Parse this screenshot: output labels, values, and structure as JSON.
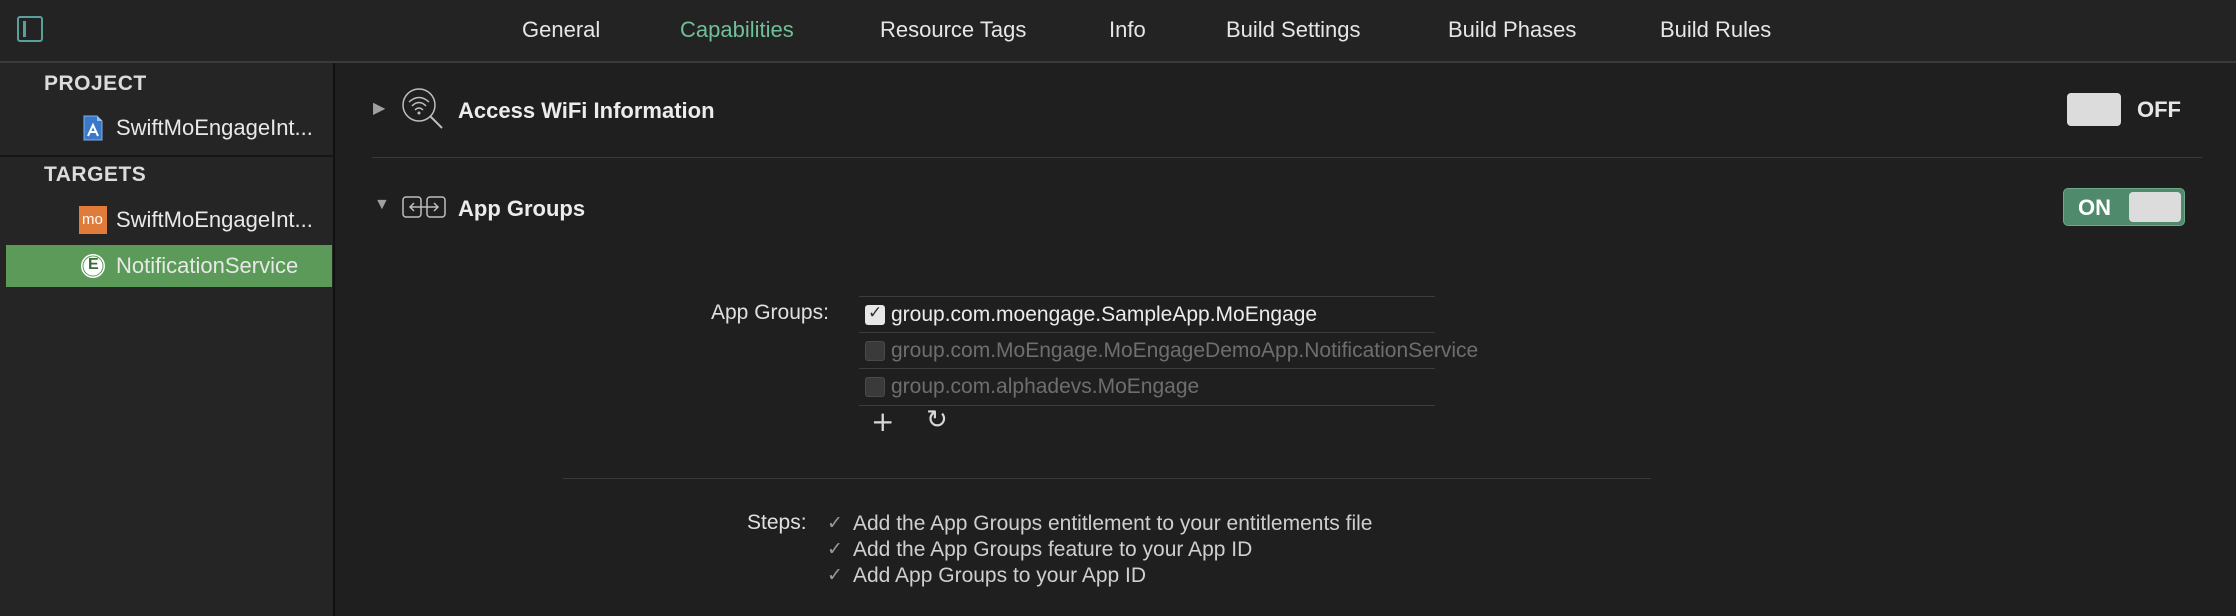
{
  "tabs": [
    {
      "label": "General"
    },
    {
      "label": "Capabilities"
    },
    {
      "label": "Resource Tags"
    },
    {
      "label": "Info"
    },
    {
      "label": "Build Settings"
    },
    {
      "label": "Build Phases"
    },
    {
      "label": "Build Rules"
    }
  ],
  "active_tab": "Capabilities",
  "sidebar": {
    "project_header": "PROJECT",
    "project_item": "SwiftMoEngageInt...",
    "targets_header": "TARGETS",
    "target_items": [
      {
        "label": "SwiftMoEngageInt...",
        "icon_text": "mo"
      },
      {
        "label": "NotificationService",
        "icon_text": "E"
      }
    ]
  },
  "capabilities": [
    {
      "title": "Access WiFi Information",
      "state": "OFF",
      "expanded": false,
      "icon": "wifi-search-icon"
    },
    {
      "title": "App Groups",
      "state": "ON",
      "expanded": true,
      "icon": "app-groups-icon"
    }
  ],
  "app_groups": {
    "label": "App Groups:",
    "items": [
      {
        "name": "group.com.moengage.SampleApp.MoEngage",
        "checked": true
      },
      {
        "name": "group.com.MoEngage.MoEngageDemoApp.NotificationService",
        "checked": false
      },
      {
        "name": "group.com.alphadevs.MoEngage",
        "checked": false
      }
    ],
    "add_icon": "plus-icon",
    "refresh_icon": "refresh-icon"
  },
  "steps": {
    "label": "Steps:",
    "items": [
      "Add the App Groups entitlement to your entitlements file",
      "Add the App Groups feature to your App ID",
      "Add App Groups to your App ID"
    ]
  },
  "colors": {
    "accent": "#6fbf99",
    "selection": "#5b9a58",
    "toggle_on": "#4f8a6c",
    "background": "#1f1f1f"
  }
}
